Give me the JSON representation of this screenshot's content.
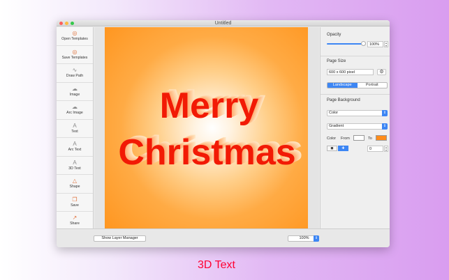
{
  "window": {
    "title": "Untitled"
  },
  "sidebar": {
    "items": [
      {
        "label": "Open Templates",
        "icon": "open-templates-icon",
        "glyph": "◎"
      },
      {
        "label": "Save Templates",
        "icon": "save-templates-icon",
        "glyph": "◎"
      },
      {
        "label": "Draw Path",
        "icon": "draw-path-icon",
        "glyph": "∿"
      },
      {
        "label": "Image",
        "icon": "image-icon",
        "glyph": "☁"
      },
      {
        "label": "Arc Image",
        "icon": "arc-image-icon",
        "glyph": "☁"
      },
      {
        "label": "Text",
        "icon": "text-icon",
        "glyph": "A"
      },
      {
        "label": "Arc Text",
        "icon": "arc-text-icon",
        "glyph": "A"
      },
      {
        "label": "3D Text",
        "icon": "3d-text-icon",
        "glyph": "A"
      },
      {
        "label": "Shape",
        "icon": "shape-icon",
        "glyph": "△"
      },
      {
        "label": "Save",
        "icon": "save-icon",
        "glyph": "❐"
      },
      {
        "label": "Share",
        "icon": "share-icon",
        "glyph": "↗"
      }
    ]
  },
  "canvas": {
    "line1": "Merry",
    "line2": "Christmas"
  },
  "panel": {
    "opacity_label": "Opacity",
    "opacity_value": "100%",
    "opacity_level": 1.0,
    "page_size_label": "Page Size",
    "page_size_value": "600 x 600 pixel",
    "orientation": {
      "landscape": "Landscape",
      "portrait": "Portrait",
      "selected": "Landscape"
    },
    "page_background_label": "Page Background",
    "background_type": "Color",
    "fill_type": "Gradient",
    "color_label": "Color",
    "from_label": "From",
    "to_label": "To",
    "from_color": "#ffffff",
    "to_color": "#ff8c1a",
    "angle_value": "0"
  },
  "bottom": {
    "layer_manager": "Show Layer Manager",
    "zoom": "100%"
  },
  "caption": "3D Text"
}
